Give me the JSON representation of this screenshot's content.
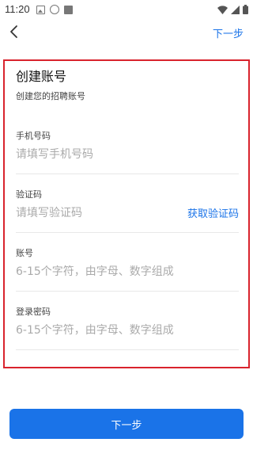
{
  "status_bar": {
    "time": "11:20",
    "icons": [
      "image-icon",
      "volume-icon",
      "app-square-icon",
      "wifi-icon",
      "signal-icon",
      "battery-icon"
    ]
  },
  "nav": {
    "back_icon": "chevron-left-icon",
    "next_label": "下一步"
  },
  "form": {
    "title": "创建账号",
    "subtitle": "创建您的招聘账号",
    "fields": [
      {
        "label": "手机号码",
        "placeholder": "请填写手机号码"
      },
      {
        "label": "验证码",
        "placeholder": "请填写验证码",
        "action": "获取验证码"
      },
      {
        "label": "账号",
        "placeholder": "6-15个字符，由字母、数字组成"
      },
      {
        "label": "登录密码",
        "placeholder": "6-15个字符，由字母、数字组成"
      }
    ]
  },
  "bottom_button": {
    "label": "下一步"
  },
  "colors": {
    "accent": "#1a73e8",
    "highlight_border": "#d9232d"
  }
}
